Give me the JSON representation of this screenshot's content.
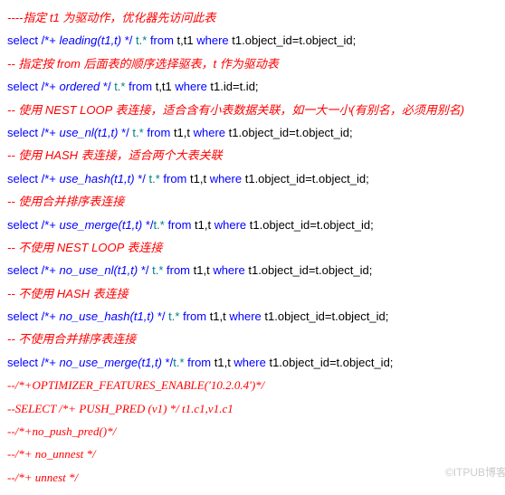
{
  "lines": [
    {
      "type": "comment",
      "text": "----指定 t1 为驱动作，优化器先访问此表"
    },
    {
      "type": "sql",
      "kw1": "select",
      "hint_open": " /*+ ",
      "hint": "leading(t1,t)",
      "hint_close": " */",
      "star": " t.* ",
      "kw2": "from",
      "tables": " t,t1 ",
      "kw3": "where",
      "cond": " t1.object_id=t.object_id;"
    },
    {
      "type": "comment",
      "text": "-- 指定按 from  后面表的顺序选择驱表，t 作为驱动表"
    },
    {
      "type": "sql",
      "kw1": "select",
      "hint_open": " /*+ ",
      "hint": "ordered",
      "hint_close": " */",
      "star": " t.* ",
      "kw2": "from",
      "tables": " t,t1 ",
      "kw3": "where",
      "cond": " t1.id=t.id;"
    },
    {
      "type": "comment",
      "text": "-- 使用 NEST LOOP  表连接，适合含有小表数据关联，如一大一小(有别名，必须用别名)"
    },
    {
      "type": "sql",
      "kw1": "select",
      "hint_open": " /*+ ",
      "hint": "use_nl(t1,t)",
      "hint_close": " */",
      "star": " t.* ",
      "kw2": "from",
      "tables": " t1,t ",
      "kw3": "where",
      "cond": " t1.object_id=t.object_id;"
    },
    {
      "type": "comment",
      "text": "-- 使用 HASH  表连接，适合两个大表关联"
    },
    {
      "type": "sql",
      "kw1": "select",
      "hint_open": " /*+ ",
      "hint": "use_hash(t1,t)",
      "hint_close": " */",
      "star": " t.* ",
      "kw2": "from",
      "tables": " t1,t ",
      "kw3": "where",
      "cond": " t1.object_id=t.object_id;"
    },
    {
      "type": "comment",
      "text": "-- 使用合并排序表连接"
    },
    {
      "type": "sql",
      "kw1": "select",
      "hint_open": " /*+ ",
      "hint": "use_merge(t1,t)",
      "hint_close": " */",
      "star": "t.*  ",
      "kw2": "from",
      "tables": " t1,t ",
      "kw3": "where",
      "cond": " t1.object_id=t.object_id;"
    },
    {
      "type": "comment",
      "text": "-- 不使用 NEST LOOP  表连接"
    },
    {
      "type": "sql",
      "kw1": "select",
      "hint_open": " /*+ ",
      "hint": "no_use_nl(t1,t)",
      "hint_close": " */",
      "star": " t.*  ",
      "kw2": "from",
      "tables": " t1,t ",
      "kw3": "where",
      "cond": " t1.object_id=t.object_id;"
    },
    {
      "type": "comment",
      "text": "-- 不使用 HASH  表连接"
    },
    {
      "type": "sql",
      "kw1": "select",
      "hint_open": " /*+ ",
      "hint": "no_use_hash(t1,t)",
      "hint_close": " */",
      "star": " t.* ",
      "kw2": "from",
      "tables": " t1,t ",
      "kw3": "where",
      "cond": " t1.object_id=t.object_id;"
    },
    {
      "type": "comment",
      "text": "-- 不使用合并排序表连接"
    },
    {
      "type": "sql",
      "kw1": "select",
      "hint_open": " /*+ ",
      "hint": "no_use_merge(t1,t)",
      "hint_close": " */",
      "star": "t.* ",
      "kw2": "from",
      "tables": " t1,t ",
      "kw3": "where",
      "cond": " t1.object_id=t.object_id;"
    },
    {
      "type": "comment-serif",
      "text": "--/*+OPTIMIZER_FEATURES_ENABLE('10.2.0.4')*/"
    },
    {
      "type": "comment-serif",
      "text": "--SELECT /*+ PUSH_PRED (v1) */ t1.c1,v1.c1"
    },
    {
      "type": "comment-serif",
      "text": "--/*+no_push_pred()*/"
    },
    {
      "type": "comment-serif",
      "text": "--/*+ no_unnest */"
    },
    {
      "type": "comment-serif",
      "text": "--/*+  unnest  */"
    }
  ],
  "watermark": "©ITPUB博客"
}
